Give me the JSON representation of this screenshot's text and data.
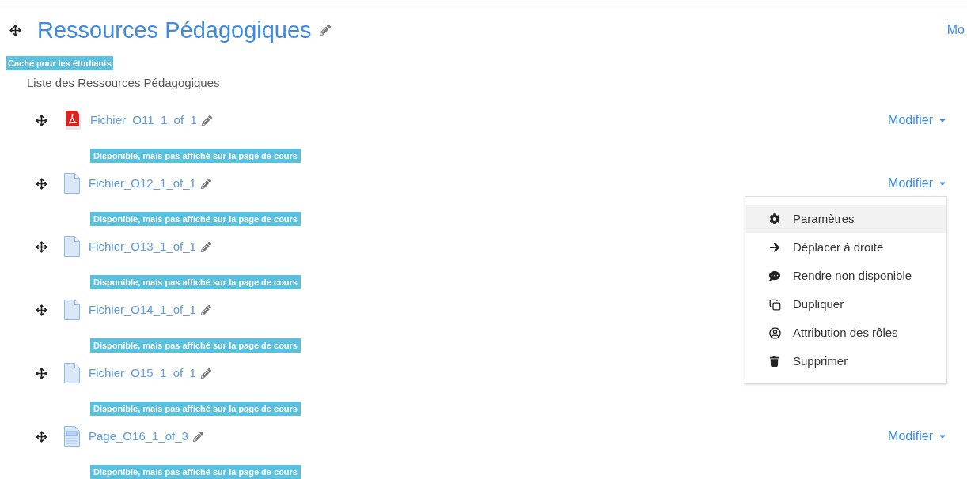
{
  "section": {
    "title": "Ressources Pédagogiques",
    "right_text": "Mo",
    "badge": "Caché pour les étudiants",
    "description": "Liste des Ressources Pédagogiques"
  },
  "items": [
    {
      "kind": "pdf",
      "name": "Fichier_O11_1_of_1",
      "action": "Modifier",
      "badge": "Disponible, mais pas affiché sur la page de cours"
    },
    {
      "kind": "file",
      "name": "Fichier_O12_1_of_1",
      "action": "Modifier",
      "badge": "Disponible, mais pas affiché sur la page de cours"
    },
    {
      "kind": "file",
      "name": "Fichier_O13_1_of_1",
      "badge": "Disponible, mais pas affiché sur la page de cours"
    },
    {
      "kind": "file",
      "name": "Fichier_O14_1_of_1",
      "badge": "Disponible, mais pas affiché sur la page de cours"
    },
    {
      "kind": "file",
      "name": "Fichier_O15_1_of_1",
      "badge": "Disponible, mais pas affiché sur la page de cours"
    },
    {
      "kind": "page",
      "name": "Page_O16_1_of_3",
      "action": "Modifier",
      "badge": "Disponible, mais pas affiché sur la page de cours"
    }
  ],
  "menu": {
    "items": [
      {
        "kind": "settings",
        "label": "Paramètres",
        "selected": true
      },
      {
        "kind": "move-right",
        "label": "Déplacer à droite",
        "selected": false
      },
      {
        "kind": "hide",
        "label": "Rendre non disponible",
        "selected": false
      },
      {
        "kind": "duplicate",
        "label": "Dupliquer",
        "selected": false
      },
      {
        "kind": "roles",
        "label": "Attribution des rôles",
        "selected": false
      },
      {
        "kind": "delete",
        "label": "Supprimer",
        "selected": false
      }
    ]
  }
}
